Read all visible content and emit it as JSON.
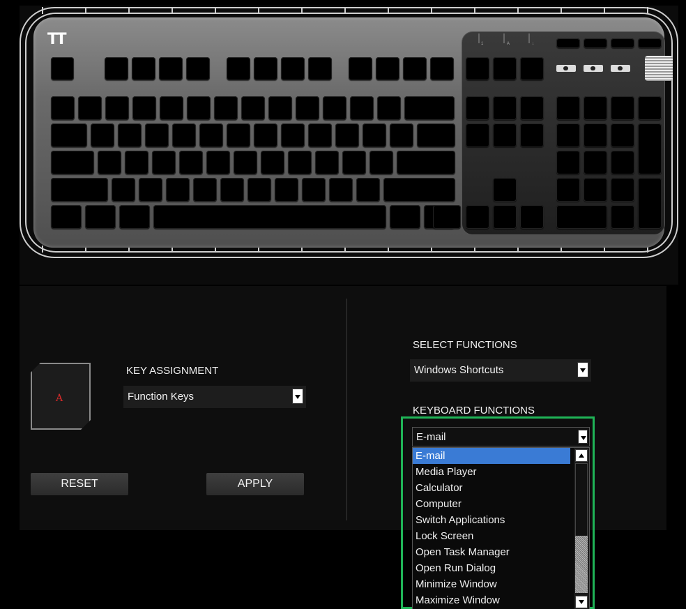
{
  "logo": {
    "text": "TT"
  },
  "keyboard": {
    "lock_indicators": [
      "1",
      "A",
      "↓"
    ],
    "media_buttons": [
      "back-icon",
      "light-icon",
      "record-icon"
    ]
  },
  "key_preview": {
    "letter": "A"
  },
  "key_assignment": {
    "label": "KEY ASSIGNMENT",
    "selected": "Function Keys"
  },
  "buttons": {
    "reset": "RESET",
    "apply": "APPLY"
  },
  "select_functions": {
    "label": "SELECT FUNCTIONS",
    "selected": "Windows Shortcuts"
  },
  "keyboard_functions": {
    "label": "KEYBOARD FUNCTIONS",
    "selected": "E-mail",
    "options": [
      "E-mail",
      "Media Player",
      "Calculator",
      "Computer",
      "Switch Applications",
      "Lock Screen",
      "Open Task Manager",
      "Open Run Dialog",
      "Minimize Window",
      "Maximize Window"
    ],
    "highlighted_index": 0
  },
  "colors": {
    "accent_highlight": "#1fb457",
    "selection": "#3a7bd5",
    "key_letter": "#d52a2a"
  }
}
